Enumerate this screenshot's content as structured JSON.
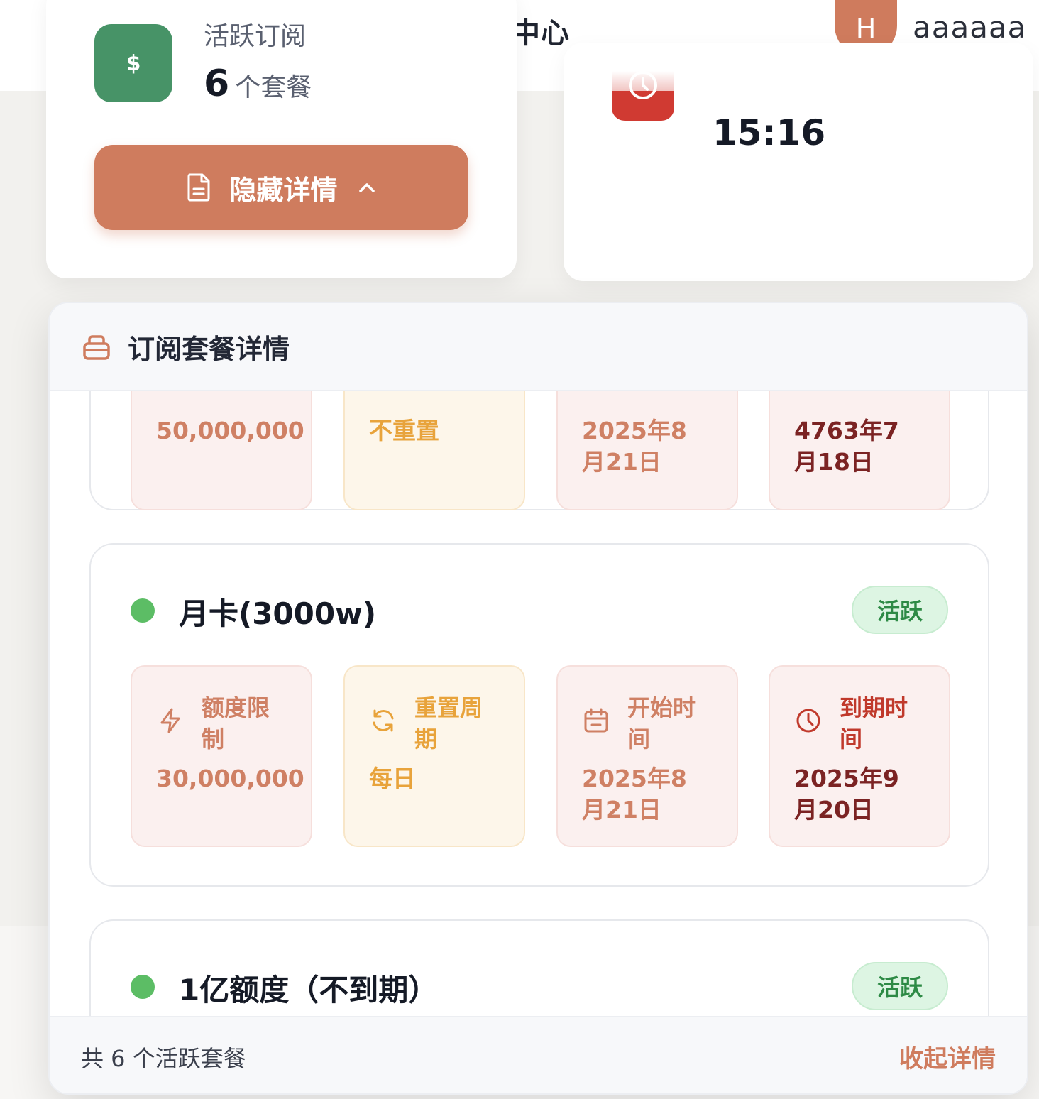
{
  "header": {
    "title_fragment": "单中心",
    "avatar_initial": "H",
    "username": "aaaaaa"
  },
  "stats": {
    "active": {
      "label": "活跃订阅",
      "value": "6",
      "unit": "个套餐",
      "icon": "dollar-icon",
      "icon_color": "#479367"
    },
    "hide_button": "隐藏详情",
    "expiry": {
      "time": "15:16",
      "icon": "clock-icon",
      "icon_color": "#d03a32"
    }
  },
  "panel": {
    "title": "订阅套餐详情",
    "footer_count": "共 6 个活跃套餐",
    "footer_collapse": "收起详情",
    "plans": [
      {
        "name": "",
        "status": "",
        "quota": "50,000,000",
        "reset": "不重置",
        "start": "2025年8月21日",
        "expire": "4763年7月18日"
      },
      {
        "name": "月卡(3000w)",
        "status": "活跃",
        "quota_label": "额度限制",
        "quota": "30,000,000",
        "reset_label": "重置周期",
        "reset": "每日",
        "start_label": "开始时间",
        "start": "2025年8月21日",
        "expire_label": "到期时间",
        "expire": "2025年9月20日"
      },
      {
        "name": "1亿额度（不到期）",
        "status": "活跃"
      }
    ]
  },
  "colors": {
    "accent": "#cf7c5e",
    "active_green": "#5cbd65",
    "quota": "#cf8064",
    "reset": "#e8a33b",
    "expire": "#7b2323"
  }
}
